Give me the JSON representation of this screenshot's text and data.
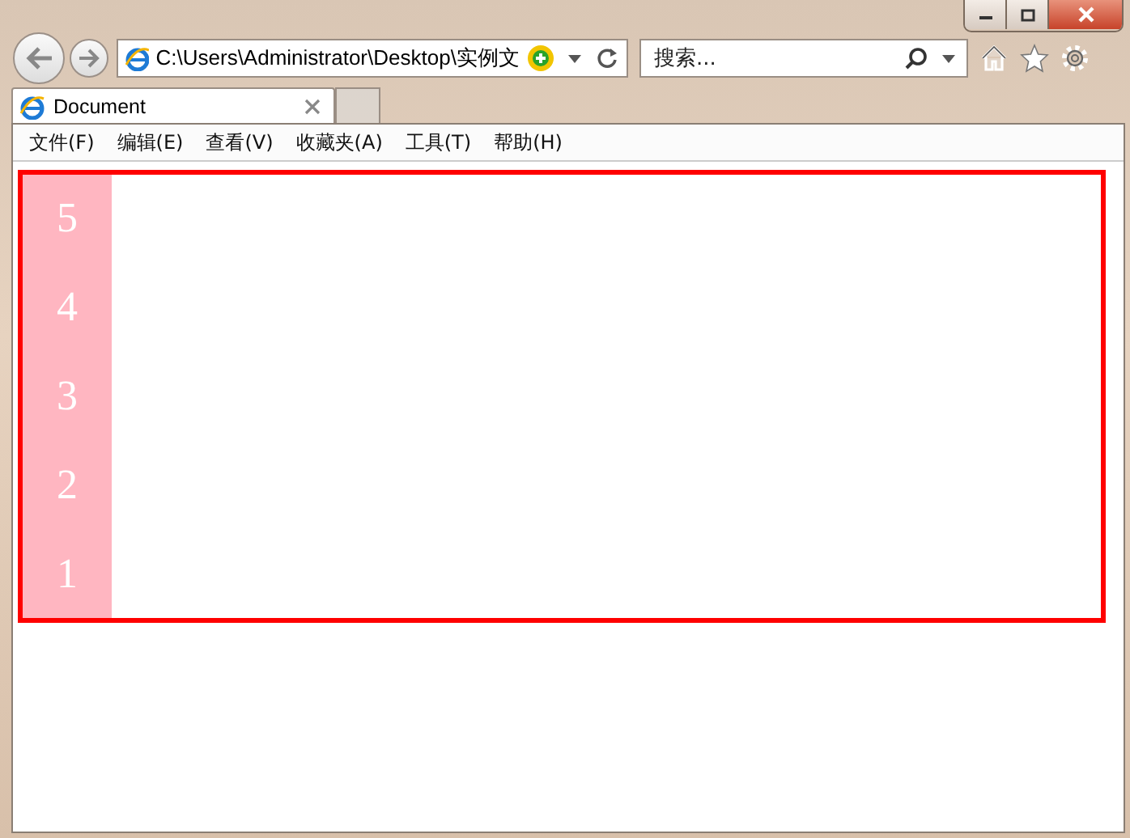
{
  "address_bar": {
    "value": "C:\\Users\\Administrator\\Desktop\\实例文"
  },
  "search": {
    "placeholder": "搜索..."
  },
  "tabs": [
    {
      "label": "Document",
      "selected": true
    }
  ],
  "menu": [
    "文件(F)",
    "编辑(E)",
    "查看(V)",
    "收藏夹(A)",
    "工具(T)",
    "帮助(H)"
  ],
  "page": {
    "numbers": [
      "5",
      "4",
      "3",
      "2",
      "1"
    ]
  }
}
